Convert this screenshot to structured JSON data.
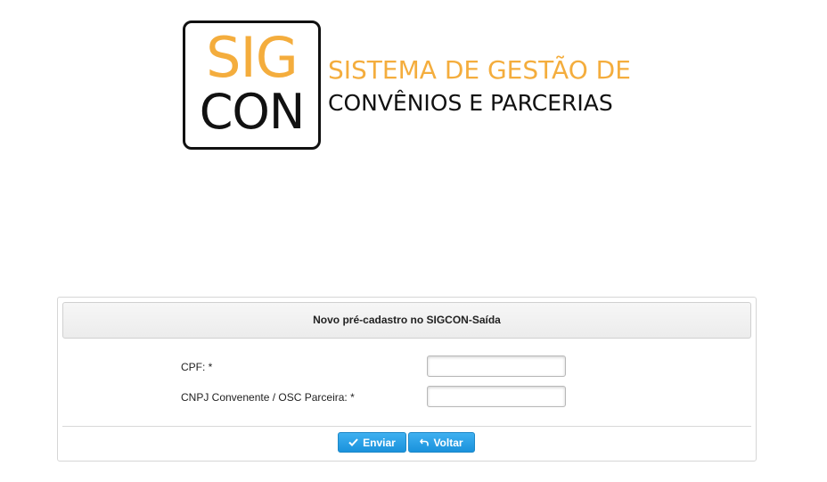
{
  "logo": {
    "line1": "SIG",
    "line2": "CON",
    "tagline1": "SISTEMA DE GESTÃO DE",
    "tagline2": "CONVÊNIOS E PARCERIAS"
  },
  "form": {
    "title": "Novo pré-cadastro no SIGCON-Saída",
    "fields": [
      {
        "label": "CPF: *",
        "value": ""
      },
      {
        "label": "CNPJ Convenente / OSC Parceira: *",
        "value": ""
      }
    ],
    "buttons": {
      "submit": "Enviar",
      "back": "Voltar"
    }
  },
  "colors": {
    "brand_orange": "#f4ad3d",
    "button_blue": "#2a9fe6"
  },
  "icons": {
    "submit": "check-icon",
    "back": "undo-arrow-icon"
  }
}
